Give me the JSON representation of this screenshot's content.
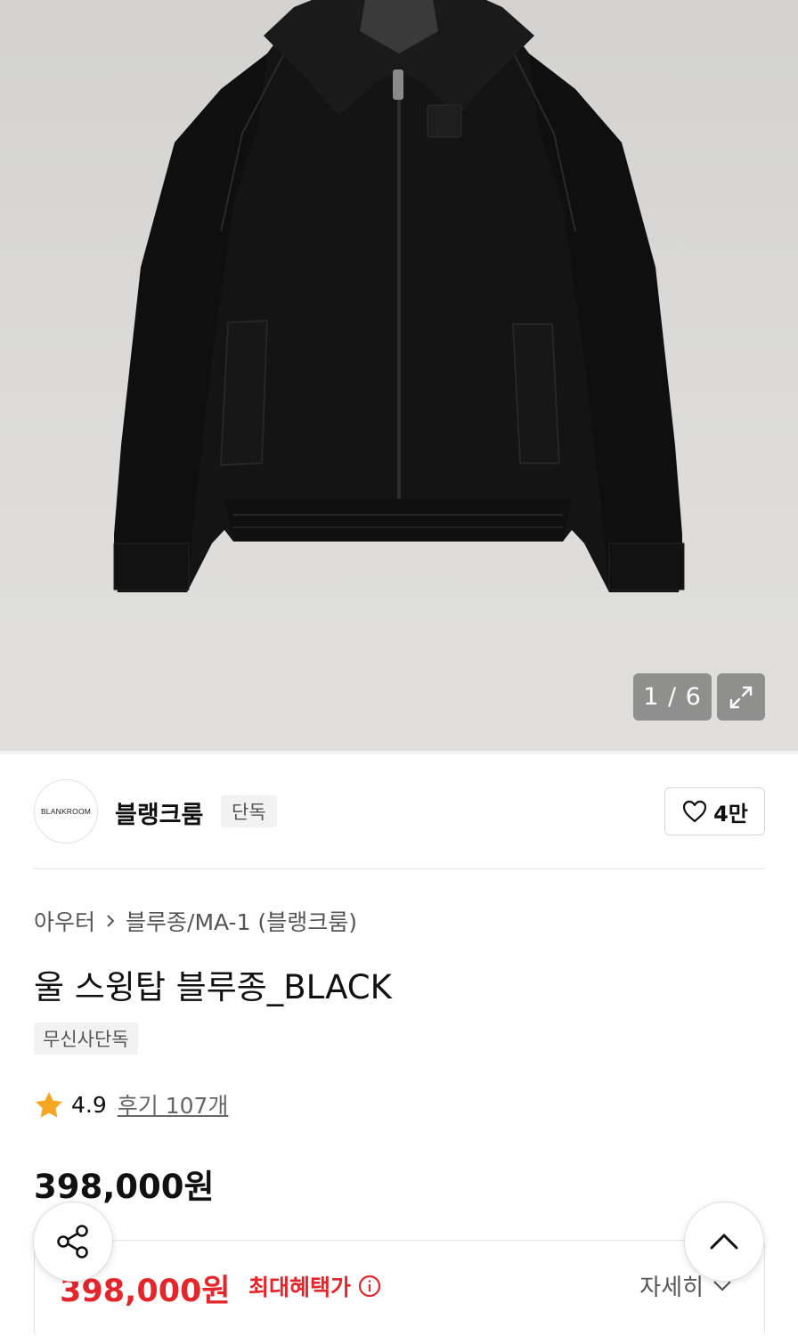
{
  "gallery": {
    "current": "1",
    "separator": "/",
    "total": "6",
    "counter_text": "1 / 6"
  },
  "brand": {
    "logo_text": "BLANKROOM",
    "name": "블랭크룸",
    "badge": "단독",
    "likes": "4만"
  },
  "breadcrumb": {
    "category": "아우터",
    "subcategory": "블루종/MA-1 (블랭크룸)"
  },
  "product": {
    "title": "울 스윙탑 블루종_BLACK",
    "exclusive_tag": "무신사단독",
    "rating": "4.9",
    "reviews": "후기 107개",
    "price": "398,000원"
  },
  "benefit": {
    "price": "398,000원",
    "label": "최대혜택가",
    "detail_link": "자세히"
  },
  "colors": {
    "accent_red": "#e4262b",
    "star": "#f5a623",
    "jacket": "#141414"
  }
}
